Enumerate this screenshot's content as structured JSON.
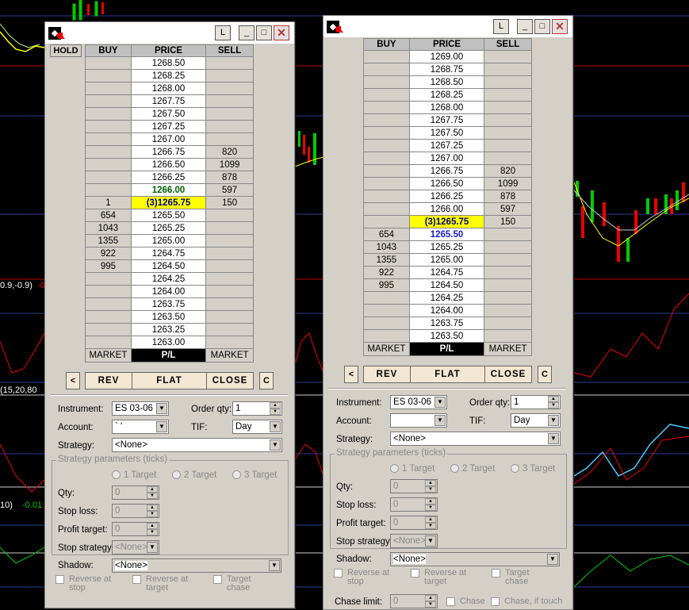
{
  "chart_background": {
    "axis_labels": [
      "0.9,-0.9)",
      "(15,20,80",
      "10)",
      "-0.01",
      "-0."
    ]
  },
  "window1": {
    "title_icons": {
      "logo": "diamond-logo-icon",
      "lock": "L",
      "minimize": "_",
      "maximize": "□",
      "close": "✕"
    },
    "hold_label": "HOLD",
    "headers": [
      "BUY",
      "PRICE",
      "SELL"
    ],
    "rows": [
      {
        "buy": "",
        "price": "1268.50",
        "sell": ""
      },
      {
        "buy": "",
        "price": "1268.25",
        "sell": ""
      },
      {
        "buy": "",
        "price": "1268.00",
        "sell": ""
      },
      {
        "buy": "",
        "price": "1267.75",
        "sell": ""
      },
      {
        "buy": "",
        "price": "1267.50",
        "sell": ""
      },
      {
        "buy": "",
        "price": "1267.25",
        "sell": ""
      },
      {
        "buy": "",
        "price": "1267.00",
        "sell": ""
      },
      {
        "buy": "",
        "price": "1266.75",
        "sell": "820"
      },
      {
        "buy": "",
        "price": "1266.50",
        "sell": "1099"
      },
      {
        "buy": "",
        "price": "1266.25",
        "sell": "878"
      },
      {
        "buy": "",
        "price": "1266.00",
        "sell": "597",
        "style": "gr"
      },
      {
        "buy": "1",
        "price": "(3)1265.75",
        "sell": "150",
        "style": "hl"
      },
      {
        "buy": "654",
        "price": "1265.50",
        "sell": ""
      },
      {
        "buy": "1043",
        "price": "1265.25",
        "sell": ""
      },
      {
        "buy": "1355",
        "price": "1265.00",
        "sell": ""
      },
      {
        "buy": "922",
        "price": "1264.75",
        "sell": ""
      },
      {
        "buy": "995",
        "price": "1264.50",
        "sell": ""
      },
      {
        "buy": "",
        "price": "1264.25",
        "sell": ""
      },
      {
        "buy": "",
        "price": "1264.00",
        "sell": ""
      },
      {
        "buy": "",
        "price": "1263.75",
        "sell": ""
      },
      {
        "buy": "",
        "price": "1263.50",
        "sell": ""
      },
      {
        "buy": "",
        "price": "1263.25",
        "sell": ""
      },
      {
        "buy": "",
        "price": "1263.00",
        "sell": ""
      }
    ],
    "footer": [
      "MARKET",
      "P/L",
      "MARKET"
    ],
    "actions": {
      "left": "<",
      "rev": "REV",
      "flat": "FLAT",
      "close": "CLOSE",
      "c": "C"
    },
    "order": {
      "instrument_label": "Instrument:",
      "instrument": "ES 03-06",
      "order_qty_label": "Order qty:",
      "order_qty": "1",
      "account_label": "Account:",
      "account": "` '",
      "tif_label": "TIF:",
      "tif": "Day",
      "strategy_label": "Strategy:",
      "strategy": "<None>"
    },
    "strategy_params": {
      "legend": "Strategy parameters (ticks)",
      "targets": [
        "1 Target",
        "2 Target",
        "3 Target"
      ],
      "qty_label": "Qty:",
      "qty": "0",
      "stop_loss_label": "Stop loss:",
      "stop_loss": "0",
      "profit_target_label": "Profit target:",
      "profit_target": "0",
      "stop_strategy_label": "Stop strategy:",
      "stop_strategy": "<None>"
    },
    "shadow": {
      "label": "Shadow:",
      "value": "<None>"
    },
    "checkboxes": [
      "Reverse at stop",
      "Reverse at target",
      "Target chase"
    ]
  },
  "window2": {
    "title_icons": {
      "logo": "diamond-logo-icon",
      "lock": "L",
      "minimize": "_",
      "maximize": "□",
      "close": "✕"
    },
    "headers": [
      "BUY",
      "PRICE",
      "SELL"
    ],
    "rows": [
      {
        "buy": "",
        "price": "1269.00",
        "sell": ""
      },
      {
        "buy": "",
        "price": "1268.75",
        "sell": ""
      },
      {
        "buy": "",
        "price": "1268.50",
        "sell": ""
      },
      {
        "buy": "",
        "price": "1268.25",
        "sell": ""
      },
      {
        "buy": "",
        "price": "1268.00",
        "sell": ""
      },
      {
        "buy": "",
        "price": "1267.75",
        "sell": ""
      },
      {
        "buy": "",
        "price": "1267.50",
        "sell": ""
      },
      {
        "buy": "",
        "price": "1267.25",
        "sell": ""
      },
      {
        "buy": "",
        "price": "1267.00",
        "sell": ""
      },
      {
        "buy": "",
        "price": "1266.75",
        "sell": "820"
      },
      {
        "buy": "",
        "price": "1266.50",
        "sell": "1099"
      },
      {
        "buy": "",
        "price": "1266.25",
        "sell": "878"
      },
      {
        "buy": "",
        "price": "1266.00",
        "sell": "597"
      },
      {
        "buy": "",
        "price": "(3)1265.75",
        "sell": "150",
        "style": "hl"
      },
      {
        "buy": "654",
        "price": "1265.50",
        "sell": "",
        "style": "bl"
      },
      {
        "buy": "1043",
        "price": "1265.25",
        "sell": ""
      },
      {
        "buy": "1355",
        "price": "1265.00",
        "sell": ""
      },
      {
        "buy": "922",
        "price": "1264.75",
        "sell": ""
      },
      {
        "buy": "995",
        "price": "1264.50",
        "sell": ""
      },
      {
        "buy": "",
        "price": "1264.25",
        "sell": ""
      },
      {
        "buy": "",
        "price": "1264.00",
        "sell": ""
      },
      {
        "buy": "",
        "price": "1263.75",
        "sell": ""
      },
      {
        "buy": "",
        "price": "1263.50",
        "sell": ""
      }
    ],
    "footer": [
      "MARKET",
      "P/L",
      "MARKET"
    ],
    "actions": {
      "left": "<",
      "rev": "REV",
      "flat": "FLAT",
      "close": "CLOSE",
      "c": "C"
    },
    "order": {
      "instrument_label": "Instrument:",
      "instrument": "ES 03-06",
      "order_qty_label": "Order qty:",
      "order_qty": "1",
      "account_label": "Account:",
      "account": "",
      "tif_label": "TIF:",
      "tif": "Day",
      "strategy_label": "Strategy:",
      "strategy": "<None>"
    },
    "strategy_params": {
      "legend": "Strategy parameters (ticks)",
      "targets": [
        "1 Target",
        "2 Target",
        "3 Target"
      ],
      "qty_label": "Qty:",
      "qty": "0",
      "stop_loss_label": "Stop loss:",
      "stop_loss": "0",
      "profit_target_label": "Profit target:",
      "profit_target": "0",
      "stop_strategy_label": "Stop strategy:",
      "stop_strategy": "<None>"
    },
    "shadow": {
      "label": "Shadow:",
      "value": "<None>"
    },
    "checkboxes": [
      "Reverse at stop",
      "Reverse at target",
      "Target chase"
    ],
    "chase": {
      "label": "Chase limit:",
      "value": "0",
      "chase_label": "Chase",
      "chase_if_touch_label": "Chase, if touch"
    }
  }
}
